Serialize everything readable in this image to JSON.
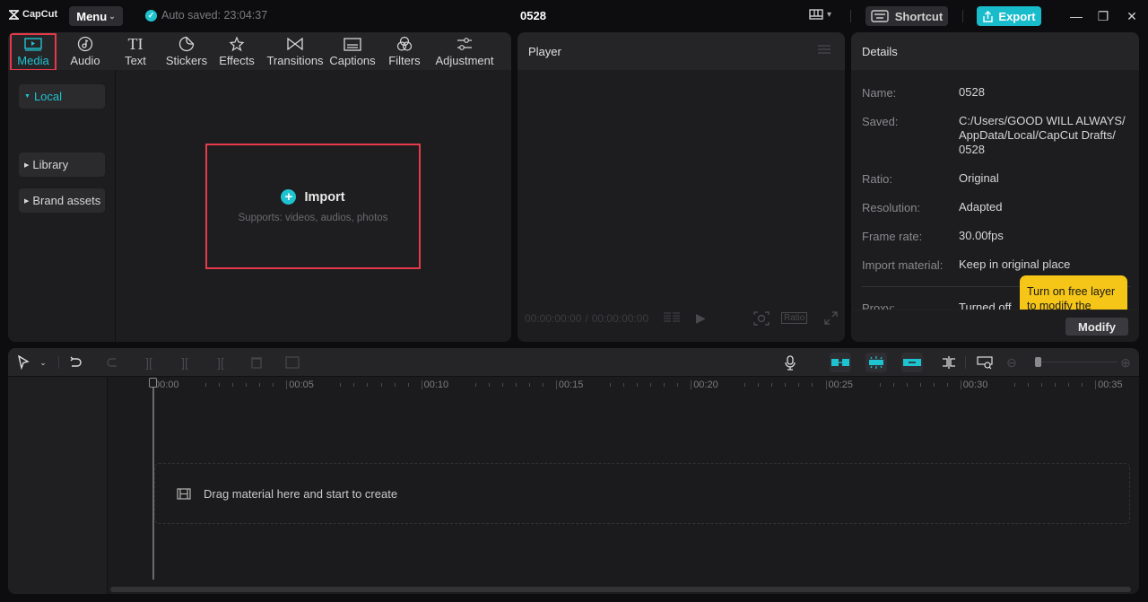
{
  "app": {
    "logo_text": "CapCut",
    "menu_label": "Menu",
    "autosave_text": "Auto saved: 23:04:37",
    "project_title": "0528",
    "shortcut_label": "Shortcut",
    "export_label": "Export",
    "accent_color": "#1fc2cf",
    "highlight_color": "#e43a4a"
  },
  "media_tabs": [
    {
      "label": "Media",
      "icon": "media-icon",
      "active": true
    },
    {
      "label": "Audio",
      "icon": "audio-icon"
    },
    {
      "label": "Text",
      "icon": "text-icon"
    },
    {
      "label": "Stickers",
      "icon": "stickers-icon"
    },
    {
      "label": "Effects",
      "icon": "effects-icon"
    },
    {
      "label": "Transitions",
      "icon": "transitions-icon"
    },
    {
      "label": "Captions",
      "icon": "captions-icon"
    },
    {
      "label": "Filters",
      "icon": "filters-icon"
    },
    {
      "label": "Adjustment",
      "icon": "adjustment-icon"
    }
  ],
  "sidebar": {
    "local": "Local",
    "import": "Import",
    "library": "Library",
    "brand_assets": "Brand assets"
  },
  "import_zone": {
    "label": "Import",
    "sub": "Supports: videos, audios, photos"
  },
  "player": {
    "title": "Player",
    "current_time": "00:00:00:00",
    "separator": "/",
    "total_time": "00:00:00:00",
    "ratio_label": "Ratio"
  },
  "details": {
    "title": "Details",
    "rows": [
      {
        "label": "Name:",
        "value": "0528"
      },
      {
        "label": "Saved:",
        "value_lines": [
          "C:/Users/GOOD WILL ALWAYS/",
          "AppData/Local/CapCut Drafts/",
          "0528"
        ]
      },
      {
        "label": "Ratio:",
        "value": "Original"
      },
      {
        "label": "Resolution:",
        "value": "Adapted"
      },
      {
        "label": "Frame rate:",
        "value": "30.00fps"
      },
      {
        "label": "Import material:",
        "value": "Keep in original place"
      },
      {
        "label": "Proxy:",
        "value": "Turned off"
      }
    ],
    "tooltip": "Turn on free layer to modify the",
    "modify_label": "Modify"
  },
  "timeline": {
    "ruler_labels": [
      "00:00",
      "00:05",
      "00:10",
      "00:15",
      "00:20",
      "00:25",
      "00:30",
      "00:35"
    ],
    "drop_text": "Drag material here and start to create",
    "zoom_level": 0.05
  }
}
